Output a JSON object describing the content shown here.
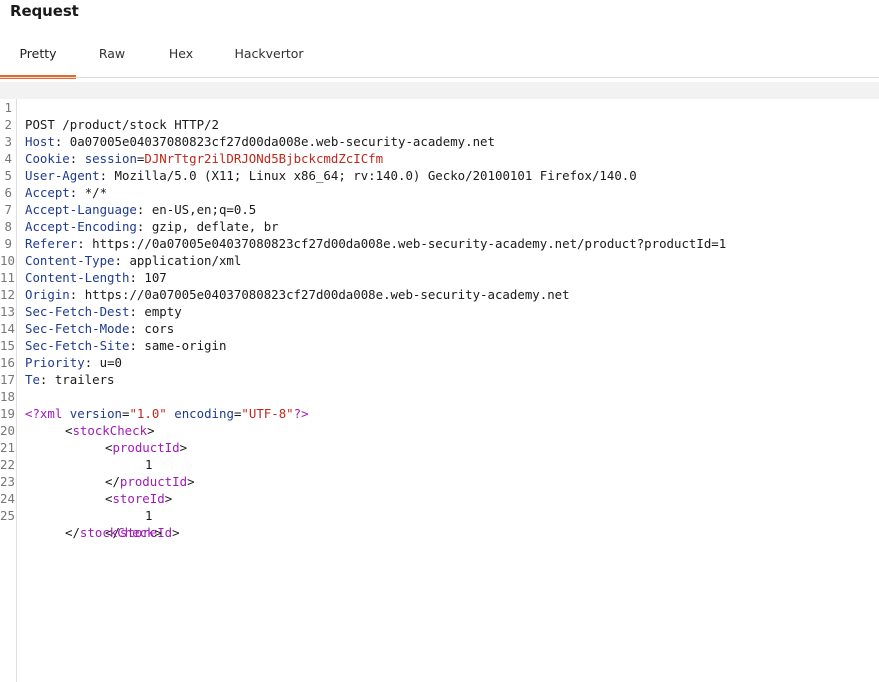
{
  "panel": {
    "title": "Request"
  },
  "tabs": [
    {
      "label": "Pretty",
      "active": true
    },
    {
      "label": "Raw",
      "active": false
    },
    {
      "label": "Hex",
      "active": false
    },
    {
      "label": "Hackvertor",
      "active": false
    }
  ],
  "colors": {
    "accent": "#e36a2c",
    "header_name": "#1f3b8f",
    "cookie_value": "#c0281b",
    "xml_tag": "#a21ab8"
  },
  "request": {
    "line_numbers": [
      "1",
      "2",
      "3",
      "4",
      "5",
      "6",
      "7",
      "8",
      "9",
      "10",
      "11",
      "12",
      "13",
      "14",
      "15",
      "16",
      "17",
      "18",
      "19",
      "20",
      "21",
      "22",
      "23",
      "24",
      "25"
    ],
    "request_line": "POST /product/stock HTTP/2",
    "headers": [
      {
        "name": "Host",
        "value": "0a07005e04037080823cf27d00da008e.web-security-academy.net"
      },
      {
        "name": "Cookie",
        "cookie_name": "session",
        "cookie_value": "DJNrTtgr2ilDRJONd5BjbckcmdZcICfm"
      },
      {
        "name": "User-Agent",
        "value": "Mozilla/5.0 (X11; Linux x86_64; rv:140.0) Gecko/20100101 Firefox/140.0"
      },
      {
        "name": "Accept",
        "value": "*/*"
      },
      {
        "name": "Accept-Language",
        "value": "en-US,en;q=0.5"
      },
      {
        "name": "Accept-Encoding",
        "value": "gzip, deflate, br"
      },
      {
        "name": "Referer",
        "value": "https://0a07005e04037080823cf27d00da008e.web-security-academy.net/product?productId=1"
      },
      {
        "name": "Content-Type",
        "value": "application/xml"
      },
      {
        "name": "Content-Length",
        "value": "107"
      },
      {
        "name": "Origin",
        "value": "https://0a07005e04037080823cf27d00da008e.web-security-academy.net"
      },
      {
        "name": "Sec-Fetch-Dest",
        "value": "empty"
      },
      {
        "name": "Sec-Fetch-Mode",
        "value": "cors"
      },
      {
        "name": "Sec-Fetch-Site",
        "value": "same-origin"
      },
      {
        "name": "Priority",
        "value": "u=0"
      },
      {
        "name": "Te",
        "value": "trailers"
      }
    ],
    "xml": {
      "decl_open": "<?xml",
      "version_attr": "version",
      "version_value": "\"1.0\"",
      "encoding_attr": "encoding",
      "encoding_value": "\"UTF-8\"",
      "decl_close": "?>",
      "root_tag": "stockCheck",
      "product_tag": "productId",
      "product_value": "1",
      "store_tag": "storeId",
      "store_value": "1"
    }
  }
}
